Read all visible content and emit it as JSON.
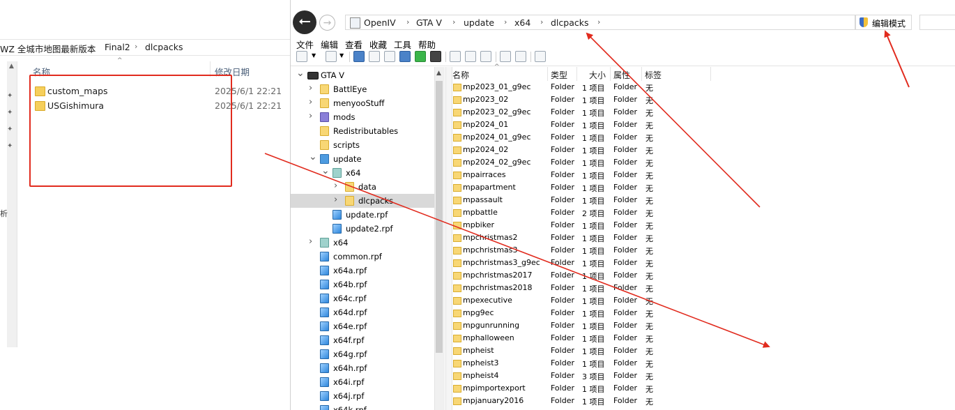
{
  "explorer": {
    "breadcrumb": [
      "WZ 全城市地图最新版本",
      "Final2",
      "dlcpacks"
    ],
    "columns": {
      "name": "名称",
      "date": "修改日期"
    },
    "files": [
      {
        "name": "custom_maps",
        "date": "2025/6/1 22:21"
      },
      {
        "name": "USGishimura",
        "date": "2025/6/1 22:21"
      }
    ],
    "side_text": "析"
  },
  "openiv": {
    "breadcrumb": [
      "OpenIV",
      "GTA V",
      "update",
      "x64",
      "dlcpacks"
    ],
    "edit_mode_label": "编辑模式",
    "menu": [
      "文件",
      "编辑",
      "查看",
      "收藏",
      "工具",
      "帮助"
    ],
    "tree": [
      {
        "label": "GTA V",
        "level": 0,
        "icon": "game-icon",
        "expand": "expanded"
      },
      {
        "label": "BattlEye",
        "level": 1,
        "icon": "folder-icon",
        "expand": "collapsed"
      },
      {
        "label": "menyooStuff",
        "level": 1,
        "icon": "folder-icon",
        "expand": "collapsed"
      },
      {
        "label": "mods",
        "level": 1,
        "icon": "mods-folder-icon",
        "expand": "collapsed"
      },
      {
        "label": "Redistributables",
        "level": 1,
        "icon": "folder-icon",
        "expand": "none"
      },
      {
        "label": "scripts",
        "level": 1,
        "icon": "folder-icon",
        "expand": "none"
      },
      {
        "label": "update",
        "level": 1,
        "icon": "update-icon",
        "expand": "expanded"
      },
      {
        "label": "x64",
        "level": 2,
        "icon": "archive-icon",
        "expand": "expanded"
      },
      {
        "label": "data",
        "level": 3,
        "icon": "data-folder-icon",
        "expand": "collapsed"
      },
      {
        "label": "dlcpacks",
        "level": 3,
        "icon": "folder-icon",
        "expand": "collapsed",
        "selected": true
      },
      {
        "label": "update.rpf",
        "level": 2,
        "icon": "rpf-icon",
        "expand": "none"
      },
      {
        "label": "update2.rpf",
        "level": 2,
        "icon": "rpf-icon",
        "expand": "none"
      },
      {
        "label": "x64",
        "level": 1,
        "icon": "archive-icon",
        "expand": "collapsed"
      },
      {
        "label": "common.rpf",
        "level": 1,
        "icon": "rpf-icon",
        "expand": "none"
      },
      {
        "label": "x64a.rpf",
        "level": 1,
        "icon": "rpf-icon",
        "expand": "none"
      },
      {
        "label": "x64b.rpf",
        "level": 1,
        "icon": "rpf-icon",
        "expand": "none"
      },
      {
        "label": "x64c.rpf",
        "level": 1,
        "icon": "rpf-icon",
        "expand": "none"
      },
      {
        "label": "x64d.rpf",
        "level": 1,
        "icon": "rpf-icon",
        "expand": "none"
      },
      {
        "label": "x64e.rpf",
        "level": 1,
        "icon": "rpf-icon",
        "expand": "none"
      },
      {
        "label": "x64f.rpf",
        "level": 1,
        "icon": "rpf-icon",
        "expand": "none"
      },
      {
        "label": "x64g.rpf",
        "level": 1,
        "icon": "rpf-icon",
        "expand": "none"
      },
      {
        "label": "x64h.rpf",
        "level": 1,
        "icon": "rpf-icon",
        "expand": "none"
      },
      {
        "label": "x64i.rpf",
        "level": 1,
        "icon": "rpf-icon",
        "expand": "none"
      },
      {
        "label": "x64j.rpf",
        "level": 1,
        "icon": "rpf-icon",
        "expand": "none"
      },
      {
        "label": "x64k.rpf",
        "level": 1,
        "icon": "rpf-icon",
        "expand": "none"
      }
    ],
    "list_columns": [
      "名称",
      "类型",
      "大小",
      "属性",
      "标签"
    ],
    "list_rows": [
      {
        "name": "mp2023_01_g9ec",
        "type": "Folder",
        "size": "1 项目",
        "attr": "Folder",
        "tag": "无"
      },
      {
        "name": "mp2023_02",
        "type": "Folder",
        "size": "1 项目",
        "attr": "Folder",
        "tag": "无"
      },
      {
        "name": "mp2023_02_g9ec",
        "type": "Folder",
        "size": "1 项目",
        "attr": "Folder",
        "tag": "无"
      },
      {
        "name": "mp2024_01",
        "type": "Folder",
        "size": "1 项目",
        "attr": "Folder",
        "tag": "无"
      },
      {
        "name": "mp2024_01_g9ec",
        "type": "Folder",
        "size": "1 项目",
        "attr": "Folder",
        "tag": "无"
      },
      {
        "name": "mp2024_02",
        "type": "Folder",
        "size": "1 项目",
        "attr": "Folder",
        "tag": "无"
      },
      {
        "name": "mp2024_02_g9ec",
        "type": "Folder",
        "size": "1 项目",
        "attr": "Folder",
        "tag": "无"
      },
      {
        "name": "mpairraces",
        "type": "Folder",
        "size": "1 项目",
        "attr": "Folder",
        "tag": "无"
      },
      {
        "name": "mpapartment",
        "type": "Folder",
        "size": "1 项目",
        "attr": "Folder",
        "tag": "无"
      },
      {
        "name": "mpassault",
        "type": "Folder",
        "size": "1 项目",
        "attr": "Folder",
        "tag": "无"
      },
      {
        "name": "mpbattle",
        "type": "Folder",
        "size": "2 项目",
        "attr": "Folder",
        "tag": "无"
      },
      {
        "name": "mpbiker",
        "type": "Folder",
        "size": "1 项目",
        "attr": "Folder",
        "tag": "无"
      },
      {
        "name": "mpchristmas2",
        "type": "Folder",
        "size": "1 项目",
        "attr": "Folder",
        "tag": "无"
      },
      {
        "name": "mpchristmas3",
        "type": "Folder",
        "size": "1 项目",
        "attr": "Folder",
        "tag": "无"
      },
      {
        "name": "mpchristmas3_g9ec",
        "type": "Folder",
        "size": "1 项目",
        "attr": "Folder",
        "tag": "无"
      },
      {
        "name": "mpchristmas2017",
        "type": "Folder",
        "size": "1 项目",
        "attr": "Folder",
        "tag": "无"
      },
      {
        "name": "mpchristmas2018",
        "type": "Folder",
        "size": "1 项目",
        "attr": "Folder",
        "tag": "无"
      },
      {
        "name": "mpexecutive",
        "type": "Folder",
        "size": "1 项目",
        "attr": "Folder",
        "tag": "无"
      },
      {
        "name": "mpg9ec",
        "type": "Folder",
        "size": "1 项目",
        "attr": "Folder",
        "tag": "无"
      },
      {
        "name": "mpgunrunning",
        "type": "Folder",
        "size": "1 项目",
        "attr": "Folder",
        "tag": "无"
      },
      {
        "name": "mphalloween",
        "type": "Folder",
        "size": "1 项目",
        "attr": "Folder",
        "tag": "无"
      },
      {
        "name": "mpheist",
        "type": "Folder",
        "size": "1 项目",
        "attr": "Folder",
        "tag": "无"
      },
      {
        "name": "mpheist3",
        "type": "Folder",
        "size": "1 项目",
        "attr": "Folder",
        "tag": "无"
      },
      {
        "name": "mpheist4",
        "type": "Folder",
        "size": "3 项目",
        "attr": "Folder",
        "tag": "无"
      },
      {
        "name": "mpimportexport",
        "type": "Folder",
        "size": "1 项目",
        "attr": "Folder",
        "tag": "无"
      },
      {
        "name": "mpjanuary2016",
        "type": "Folder",
        "size": "1 项目",
        "attr": "Folder",
        "tag": "无"
      }
    ]
  },
  "annotation_color": "#e12b1e"
}
